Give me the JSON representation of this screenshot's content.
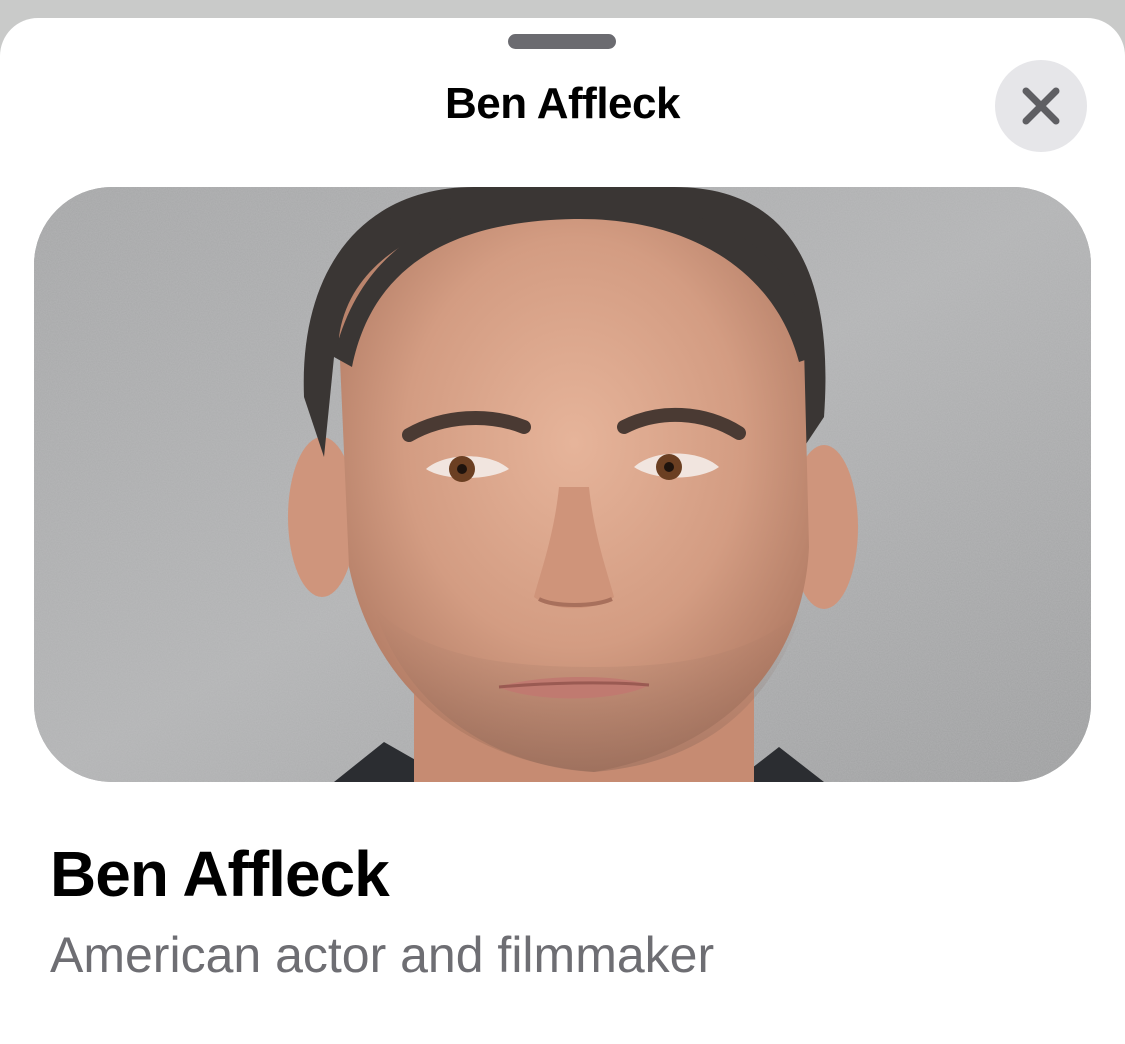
{
  "sheet": {
    "title": "Ben Affleck",
    "close_icon": "close-icon"
  },
  "card": {
    "image_alt": "portrait-photo",
    "name": "Ben Affleck",
    "description": "American actor and filmmaker"
  },
  "colors": {
    "background_dim": "#c9cac9",
    "sheet_bg": "#ffffff",
    "grabber": "#6b6b70",
    "close_bg": "#e6e6e9",
    "close_glyph": "#5f5f63",
    "title_text": "#000000",
    "secondary_text": "#6e6e73"
  }
}
